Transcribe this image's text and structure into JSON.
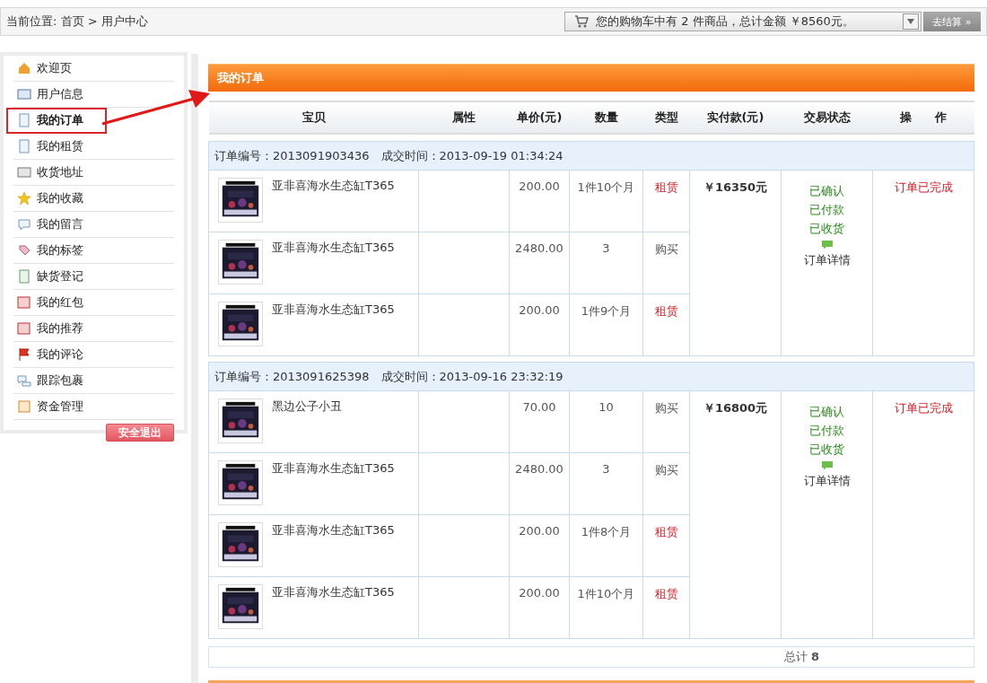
{
  "breadcrumb": {
    "label": "当前位置:",
    "path": "首页 > 用户中心"
  },
  "cart": {
    "text": "您的购物车中有 2 件商品，总计金额 ￥8560元。",
    "checkout": "去结算 »"
  },
  "sidebar": {
    "items": [
      {
        "label": "欢迎页",
        "selected": false
      },
      {
        "label": "用户信息",
        "selected": false
      },
      {
        "label": "我的订单",
        "selected": true
      },
      {
        "label": "我的租赁",
        "selected": false
      },
      {
        "label": "收货地址",
        "selected": false
      },
      {
        "label": "我的收藏",
        "selected": false
      },
      {
        "label": "我的留言",
        "selected": false
      },
      {
        "label": "我的标签",
        "selected": false
      },
      {
        "label": "缺货登记",
        "selected": false
      },
      {
        "label": "我的红包",
        "selected": false
      },
      {
        "label": "我的推荐",
        "selected": false
      },
      {
        "label": "我的评论",
        "selected": false
      },
      {
        "label": "跟踪包裹",
        "selected": false
      },
      {
        "label": "资金管理",
        "selected": false
      }
    ],
    "logout": "安全退出"
  },
  "panel": {
    "title": "我的订单"
  },
  "table": {
    "columns": [
      "宝贝",
      "属性",
      "单价(元)",
      "数量",
      "类型",
      "实付款(元)",
      "交易状态",
      "操　　作"
    ],
    "orders": [
      {
        "header": "订单编号：2013091903436　成交时间：2013-09-19 01:34:24",
        "paid": "￥16350元",
        "status": [
          "已确认",
          "已付款",
          "已收货"
        ],
        "detail": "订单详情",
        "operation": "订单已完成",
        "items": [
          {
            "name": "亚非喜海水生态缸T365",
            "price": "200.00",
            "qty": "1件10个月",
            "type": "租赁",
            "kind": "rent"
          },
          {
            "name": "亚非喜海水生态缸T365",
            "price": "2480.00",
            "qty": "3",
            "type": "购买",
            "kind": "buy"
          },
          {
            "name": "亚非喜海水生态缸T365",
            "price": "200.00",
            "qty": "1件9个月",
            "type": "租赁",
            "kind": "rent"
          }
        ]
      },
      {
        "header": "订单编号：2013091625398　成交时间：2013-09-16 23:32:19",
        "paid": "￥16800元",
        "status": [
          "已确认",
          "已付款",
          "已收货"
        ],
        "detail": "订单详情",
        "operation": "订单已完成",
        "items": [
          {
            "name": "黑边公子小丑",
            "price": "70.00",
            "qty": "10",
            "type": "购买",
            "kind": "buy"
          },
          {
            "name": "亚非喜海水生态缸T365",
            "price": "2480.00",
            "qty": "3",
            "type": "购买",
            "kind": "buy"
          },
          {
            "name": "亚非喜海水生态缸T365",
            "price": "200.00",
            "qty": "1件8个月",
            "type": "租赁",
            "kind": "rent"
          },
          {
            "name": "亚非喜海水生态缸T365",
            "price": "200.00",
            "qty": "1件10个月",
            "type": "租赁",
            "kind": "rent"
          }
        ]
      }
    ]
  },
  "footer": {
    "total": "总计 **8**"
  }
}
